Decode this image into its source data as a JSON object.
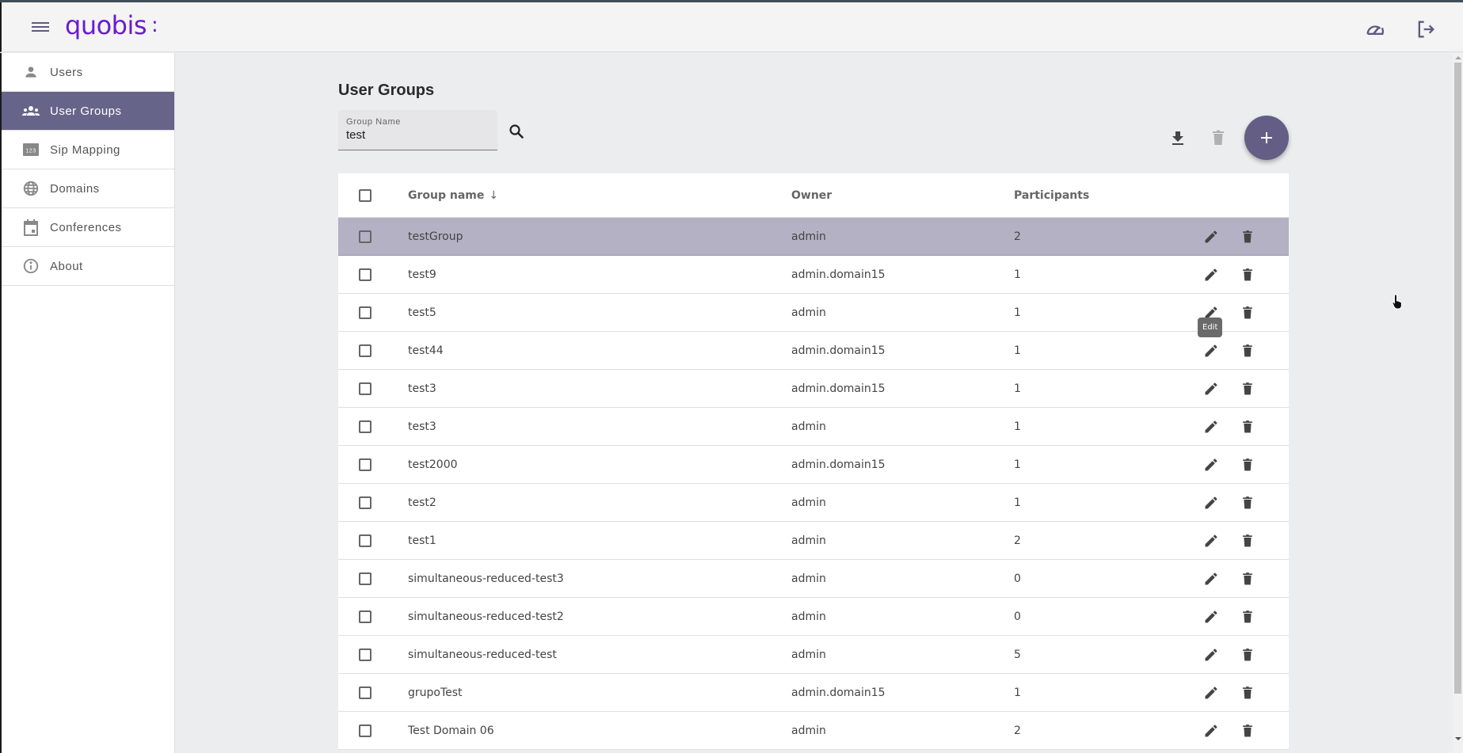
{
  "header": {
    "logo": "quobis",
    "logo_suffix": ":",
    "menu_icon": "menu-icon",
    "right_icons": [
      "dashboard-speed-icon",
      "logout-icon"
    ]
  },
  "sidebar": {
    "items": [
      {
        "label": "Users",
        "icon": "person-icon",
        "active": false
      },
      {
        "label": "User Groups",
        "icon": "groups-icon",
        "active": true
      },
      {
        "label": "Sip Mapping",
        "icon": "numbers-123-icon",
        "active": false
      },
      {
        "label": "Domains",
        "icon": "globe-icon",
        "active": false
      },
      {
        "label": "Conferences",
        "icon": "calendar-icon",
        "active": false
      },
      {
        "label": "About",
        "icon": "info-icon",
        "active": false
      }
    ]
  },
  "main": {
    "title": "User Groups",
    "search": {
      "label": "Group Name",
      "value": "test"
    },
    "toolbar": {
      "download_icon": "download-icon",
      "delete_icon": "delete-icon",
      "add_icon": "add-icon"
    },
    "table": {
      "columns": [
        "Group name",
        "Owner",
        "Participants"
      ],
      "sort_indicator": "↓",
      "rows": [
        {
          "name": "testGroup",
          "owner": "admin",
          "participants": "2",
          "selected": true
        },
        {
          "name": "test9",
          "owner": "admin.domain15",
          "participants": "1"
        },
        {
          "name": "test5",
          "owner": "admin",
          "participants": "1"
        },
        {
          "name": "test44",
          "owner": "admin.domain15",
          "participants": "1"
        },
        {
          "name": "test3",
          "owner": "admin.domain15",
          "participants": "1"
        },
        {
          "name": "test3",
          "owner": "admin",
          "participants": "1"
        },
        {
          "name": "test2000",
          "owner": "admin.domain15",
          "participants": "1"
        },
        {
          "name": "test2",
          "owner": "admin",
          "participants": "1"
        },
        {
          "name": "test1",
          "owner": "admin",
          "participants": "2"
        },
        {
          "name": "simultaneous-reduced-test3",
          "owner": "admin",
          "participants": "0"
        },
        {
          "name": "simultaneous-reduced-test2",
          "owner": "admin",
          "participants": "0"
        },
        {
          "name": "simultaneous-reduced-test",
          "owner": "admin",
          "participants": "5"
        },
        {
          "name": "grupoTest",
          "owner": "admin.domain15",
          "participants": "1"
        },
        {
          "name": "Test Domain 06",
          "owner": "admin",
          "participants": "2"
        }
      ]
    },
    "tooltip": "Edit"
  },
  "colors": {
    "brand": "#6a1ccc",
    "accent": "#645d85",
    "active_nav": "#67648a",
    "selected_row": "#b4b1c4"
  }
}
